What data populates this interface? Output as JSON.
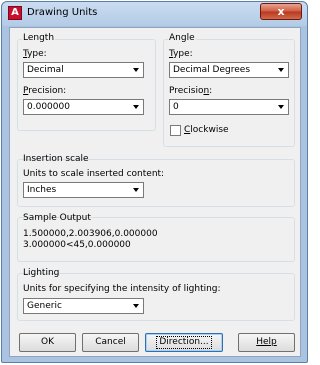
{
  "window": {
    "title": "Drawing Units",
    "close_label": "x",
    "app_icon_letter": "A"
  },
  "length": {
    "group_label": "Length",
    "type_label": "Type:",
    "type_value": "Decimal",
    "precision_label": "Precision:",
    "precision_value": "0.000000"
  },
  "angle": {
    "group_label": "Angle",
    "type_label": "Type:",
    "type_value": "Decimal Degrees",
    "precision_label": "Precision:",
    "precision_value": "0",
    "clockwise_label": "Clockwise",
    "clockwise_checked": false
  },
  "insertion": {
    "group_label": "Insertion scale",
    "description": "Units to scale inserted content:",
    "value": "Inches"
  },
  "sample": {
    "group_label": "Sample Output",
    "line1": "1.500000,2.003906,0.000000",
    "line2": "3.000000<45,0.000000"
  },
  "lighting": {
    "group_label": "Lighting",
    "description": "Units for specifying the intensity of lighting:",
    "value": "Generic"
  },
  "buttons": {
    "ok": "OK",
    "cancel": "Cancel",
    "direction": "Direction...",
    "help": "Help"
  }
}
